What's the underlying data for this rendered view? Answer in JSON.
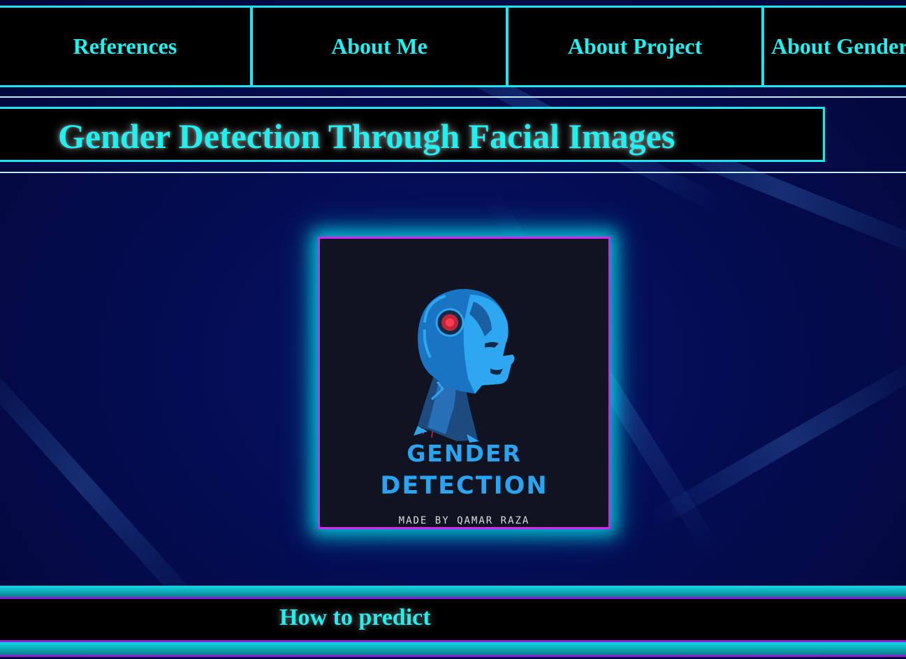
{
  "nav": {
    "items": [
      {
        "label": "References"
      },
      {
        "label": "About Me"
      },
      {
        "label": "About Project"
      },
      {
        "label": "About Gender"
      }
    ]
  },
  "header": {
    "title": "Gender Detection Through Facial Images"
  },
  "logo": {
    "line1": "GENDER",
    "line2": "DETECTION",
    "credit": "MADE BY QAMAR RAZA",
    "icon": "robot-head-icon"
  },
  "section": {
    "how_to_predict": "How to predict"
  },
  "colors": {
    "accent": "#19e6ee",
    "text_cyan": "#1ff0f0",
    "frame_magenta": "#d426f0",
    "purple_border": "#8a20d8",
    "background": "#040c52"
  }
}
